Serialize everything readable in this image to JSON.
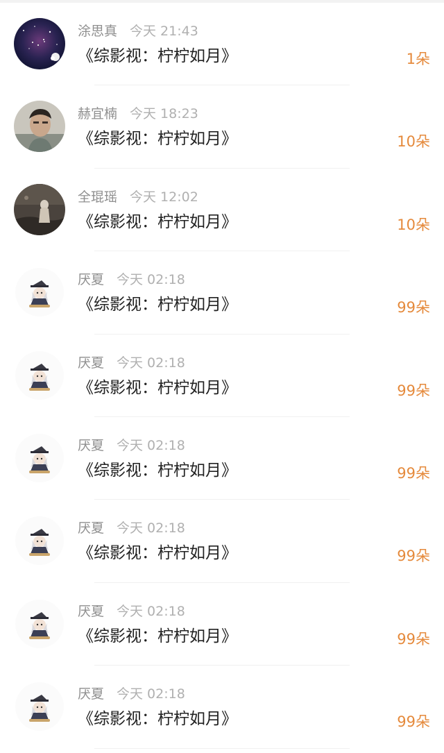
{
  "accent_color": "#e58a3c",
  "items": [
    {
      "user": "涂思真",
      "time": "今天 21:43",
      "title": "《综影视：柠柠如月》",
      "count": "1朵",
      "avatar": "starry-night-avatar"
    },
    {
      "user": "赫宜楠",
      "time": "今天 18:23",
      "title": "《综影视：柠柠如月》",
      "count": "10朵",
      "avatar": "selfie-avatar"
    },
    {
      "user": "全琨瑶",
      "time": "今天 12:02",
      "title": "《综影视：柠柠如月》",
      "count": "10朵",
      "avatar": "dark-photo-avatar"
    },
    {
      "user": "厌夏",
      "time": "今天 02:18",
      "title": "《综影视：柠柠如月》",
      "count": "99朵",
      "avatar": "anime-character-avatar"
    },
    {
      "user": "厌夏",
      "time": "今天 02:18",
      "title": "《综影视：柠柠如月》",
      "count": "99朵",
      "avatar": "anime-character-avatar"
    },
    {
      "user": "厌夏",
      "time": "今天 02:18",
      "title": "《综影视：柠柠如月》",
      "count": "99朵",
      "avatar": "anime-character-avatar"
    },
    {
      "user": "厌夏",
      "time": "今天 02:18",
      "title": "《综影视：柠柠如月》",
      "count": "99朵",
      "avatar": "anime-character-avatar"
    },
    {
      "user": "厌夏",
      "time": "今天 02:18",
      "title": "《综影视：柠柠如月》",
      "count": "99朵",
      "avatar": "anime-character-avatar"
    },
    {
      "user": "厌夏",
      "time": "今天 02:18",
      "title": "《综影视：柠柠如月》",
      "count": "99朵",
      "avatar": "anime-character-avatar"
    }
  ]
}
